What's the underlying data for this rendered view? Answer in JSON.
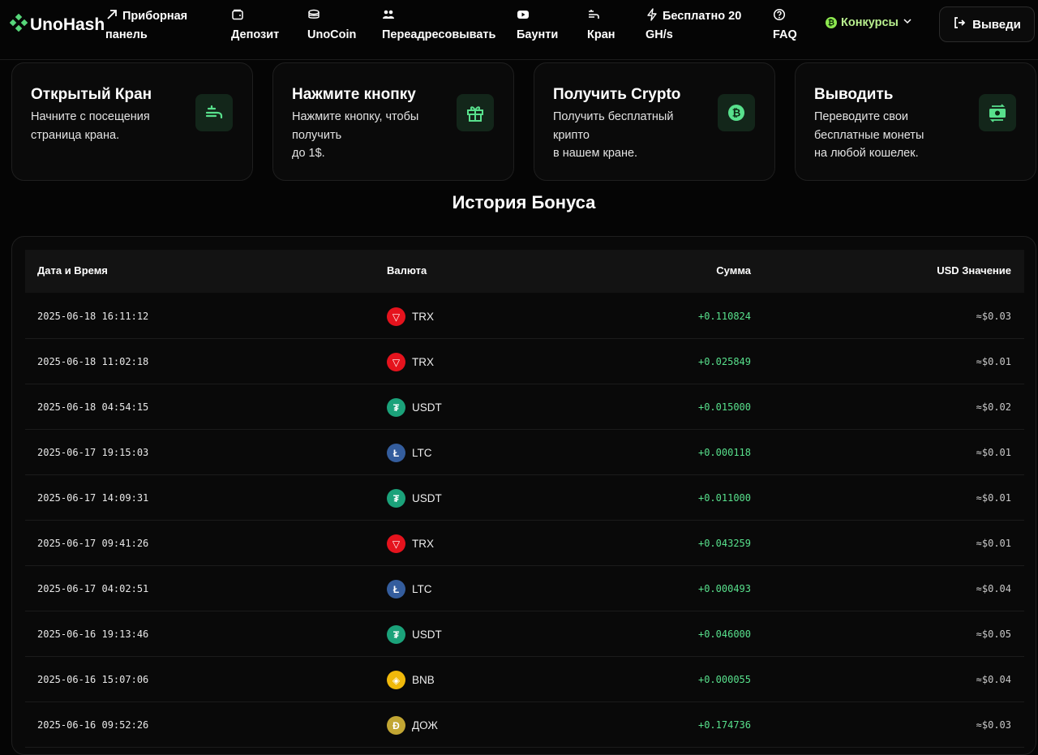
{
  "brand": {
    "name": "UnoHash"
  },
  "nav": {
    "dashboard": {
      "line1": "Приборная",
      "line2": "панель"
    },
    "deposit": "Депозит",
    "unocoin": "UnoCoin",
    "redirect": "Переадресовывать",
    "bounty": "Баунти",
    "faucet": "Кран",
    "free_gh": {
      "line1": "Бесплатно 20",
      "line2": "GH/s"
    },
    "faq": "FAQ",
    "contests": "Конкурсы",
    "withdraw": "Выведи"
  },
  "cards": [
    {
      "title": "Открытый Кран",
      "desc": "Начните с посещения\nстраница крана.",
      "icon": "faucet-icon"
    },
    {
      "title": "Нажмите кнопку",
      "desc": "Нажмите кнопку, чтобы\nполучить\nдо 1$.",
      "icon": "gift-icon"
    },
    {
      "title": "Получить Crypto",
      "desc": "Получить бесплатный\nкрипто\nв нашем кране.",
      "icon": "bitcoin-icon"
    },
    {
      "title": "Выводить",
      "desc": "Переводите свои\nбесплатные монеты\nна любой кошелек.",
      "icon": "money-transfer-icon"
    }
  ],
  "history": {
    "title": "История Бонуса",
    "columns": {
      "date": "Дата и Время",
      "currency": "Валюта",
      "amount": "Сумма",
      "usd": "USD Значение"
    },
    "rows": [
      {
        "date": "2025-06-18 16:11:12",
        "currency": "TRX",
        "amount": "+0.110824",
        "usd": "≈$0.03"
      },
      {
        "date": "2025-06-18 11:02:18",
        "currency": "TRX",
        "amount": "+0.025849",
        "usd": "≈$0.01"
      },
      {
        "date": "2025-06-18 04:54:15",
        "currency": "USDT",
        "amount": "+0.015000",
        "usd": "≈$0.02"
      },
      {
        "date": "2025-06-17 19:15:03",
        "currency": "LTC",
        "amount": "+0.000118",
        "usd": "≈$0.01"
      },
      {
        "date": "2025-06-17 14:09:31",
        "currency": "USDT",
        "amount": "+0.011000",
        "usd": "≈$0.01"
      },
      {
        "date": "2025-06-17 09:41:26",
        "currency": "TRX",
        "amount": "+0.043259",
        "usd": "≈$0.01"
      },
      {
        "date": "2025-06-17 04:02:51",
        "currency": "LTC",
        "amount": "+0.000493",
        "usd": "≈$0.04"
      },
      {
        "date": "2025-06-16 19:13:46",
        "currency": "USDT",
        "amount": "+0.046000",
        "usd": "≈$0.05"
      },
      {
        "date": "2025-06-16 15:07:06",
        "currency": "BNB",
        "amount": "+0.000055",
        "usd": "≈$0.04"
      },
      {
        "date": "2025-06-16 09:52:26",
        "currency": "ДОЖ",
        "amount": "+0.174736",
        "usd": "≈$0.03"
      }
    ]
  },
  "coin_styles": {
    "TRX": {
      "color": "#e5131d",
      "glyph": "▽"
    },
    "USDT": {
      "color": "#1ba27a",
      "glyph": "₮"
    },
    "LTC": {
      "color": "#345d9d",
      "glyph": "Ł"
    },
    "BNB": {
      "color": "#f0b90b",
      "glyph": "◈"
    },
    "ДОЖ": {
      "color": "#c2a633",
      "glyph": "Ð"
    }
  }
}
